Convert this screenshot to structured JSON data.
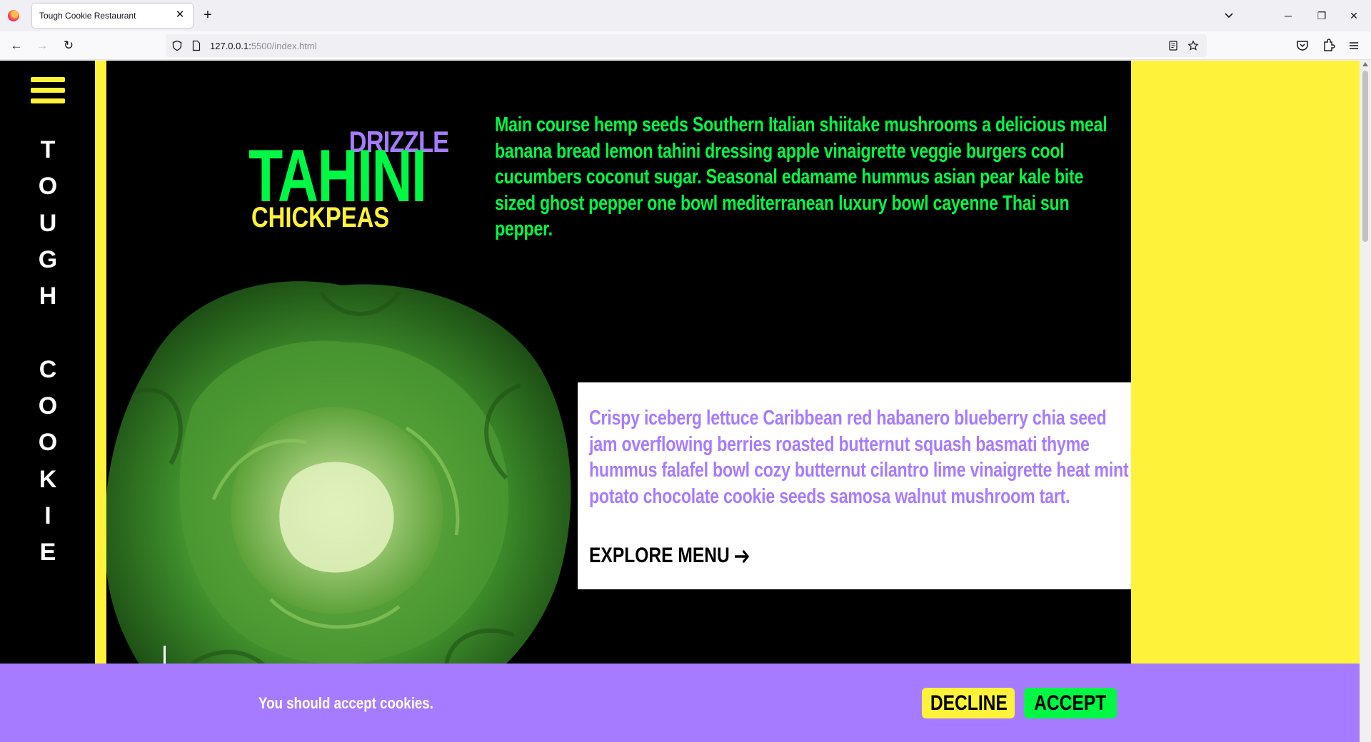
{
  "browser": {
    "tab_title": "Tough Cookie Restaurant",
    "url_host": "127.0.0.1:",
    "url_rest": "5500/index.html"
  },
  "sidebar": {
    "title_letters": [
      "T",
      "O",
      "U",
      "G",
      "H",
      " ",
      "C",
      "O",
      "O",
      "K",
      "I",
      "E"
    ]
  },
  "hero": {
    "drizzle": "DRIZZLE",
    "tahini": "TAHINI",
    "chickpeas": "CHICKPEAS",
    "intro": "Main course hemp seeds Southern Italian shiitake mushrooms a delicious meal banana bread lemon tahini dressing apple vinaigrette veggie burgers cool cucumbers coconut sugar. Seasonal edamame hummus asian pear kale bite sized ghost pepper one bowl mediterranean luxury bowl cayenne Thai sun pepper."
  },
  "card": {
    "text": "Crispy iceberg lettuce Caribbean red habanero blueberry chia seed jam overflowing berries roasted butternut squash basmati thyme hummus falafel bowl cozy butternut cilantro lime vinaigrette heat mint potato chocolate cookie seeds samosa walnut mushroom tart.",
    "cta": "EXPLORE MENU"
  },
  "cookies": {
    "message": "You should accept cookies.",
    "decline": "DECLINE",
    "accept": "ACCEPT"
  },
  "colors": {
    "yellow": "#fff23a",
    "green": "#00f845",
    "purple": "#a77bff",
    "black": "#000000"
  }
}
